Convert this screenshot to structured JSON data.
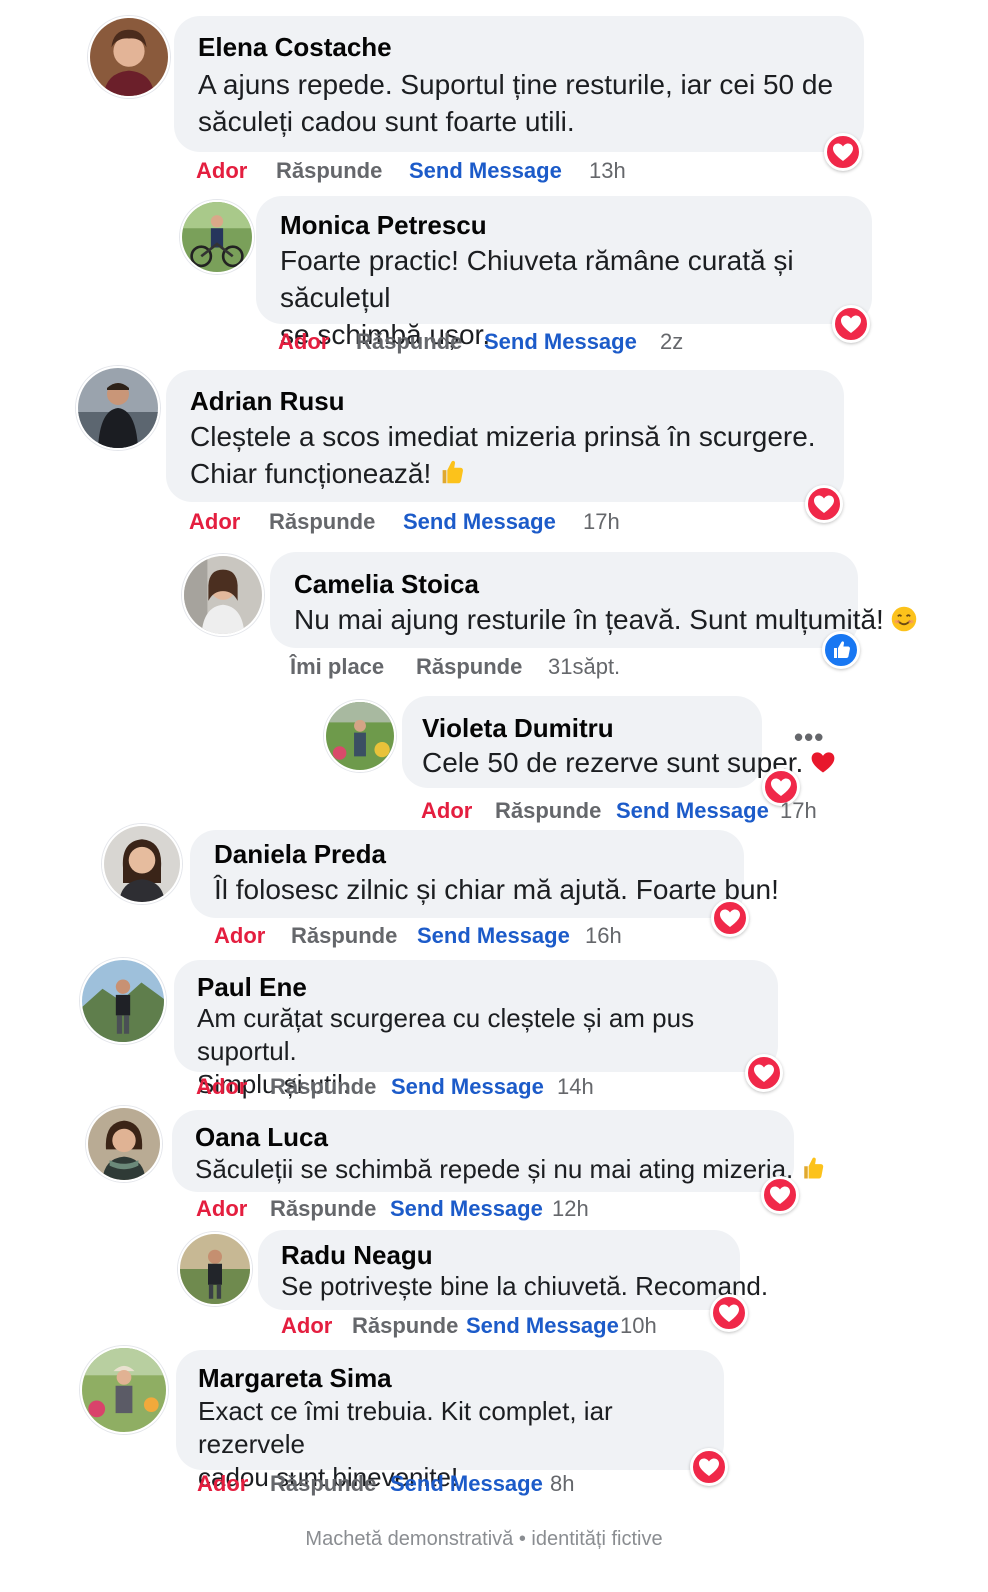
{
  "accent_colors": {
    "love": "#e41e3f",
    "send_message": "#1c5bc9",
    "meta_text": "#65676b",
    "bubble": "#f0f2f5",
    "like_blue": "#1877f2"
  },
  "actions": {
    "love": "Ador",
    "like": "Îmi place",
    "reply": "Răspunde",
    "send_message": "Send Message"
  },
  "comments": [
    {
      "author": "Elena Costache",
      "text": "A ajuns repede. Suportul ține resturile, iar cei 50 de\nsăculeți cadou sunt foarte utili.",
      "time": "13h",
      "reaction": "heart-icon"
    },
    {
      "author": "Monica Petrescu",
      "text": "Foarte practic! Chiuveta rămâne curată și săculețul\nse schimbă ușor.",
      "time": "2z",
      "reaction": "heart-icon"
    },
    {
      "author": "Adrian Rusu",
      "text": "Cleștele a scos imediat mizeria prinsă în scurgere.\nChiar funcționează!",
      "emoji": "thumbs-up-emoji",
      "time": "17h",
      "reaction": "heart-icon"
    },
    {
      "author": "Camelia Stoica",
      "text": "Nu mai ajung resturile în țeavă. Sunt mulțumită!",
      "emoji": "smile-emoji",
      "time": "31săpt.",
      "reaction": "like-icon"
    },
    {
      "author": "Violeta Dumitru",
      "text": "Cele 50 de rezerve sunt super.",
      "emoji": "red-heart-emoji",
      "time": "17h",
      "reaction": "heart-icon",
      "more": "•••"
    },
    {
      "author": "Daniela Preda",
      "text": "Îl folosesc zilnic și chiar mă ajută. Foarte bun!",
      "time": "16h",
      "reaction": "heart-icon"
    },
    {
      "author": "Paul Ene",
      "text": "Am curățat scurgerea cu cleștele și am pus suportul.\nSimplu și util.",
      "time": "14h",
      "reaction": "heart-icon"
    },
    {
      "author": "Oana Luca",
      "text": "Săculeții se schimbă repede și nu mai ating mizeria.",
      "emoji": "thumbs-up-emoji",
      "time": "12h",
      "reaction": "heart-icon"
    },
    {
      "author": "Radu Neagu",
      "text": "Se potrivește bine la chiuvetă. Recomand.",
      "time": "10h",
      "reaction": "heart-icon"
    },
    {
      "author": "Margareta Sima",
      "text": "Exact ce îmi trebuia. Kit complet, iar rezervele\ncadou sunt binevenite!",
      "time": "8h",
      "reaction": "heart-icon"
    }
  ],
  "footer": "Machetă demonstrativă • identități fictive"
}
